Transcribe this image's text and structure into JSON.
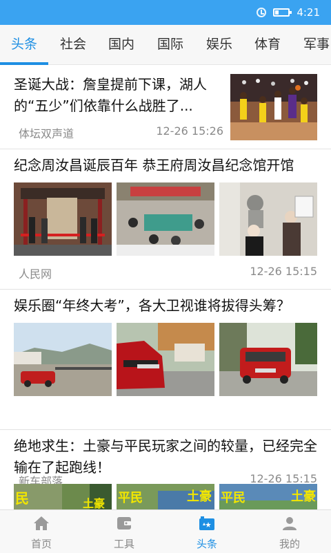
{
  "status_bar": {
    "time": "4:21",
    "battery_level": 0.25,
    "color": "#3aa3f1"
  },
  "tabs": [
    {
      "label": "头条",
      "active": true
    },
    {
      "label": "社会",
      "active": false
    },
    {
      "label": "国内",
      "active": false
    },
    {
      "label": "国际",
      "active": false
    },
    {
      "label": "娱乐",
      "active": false
    },
    {
      "label": "体育",
      "active": false
    },
    {
      "label": "军事",
      "active": false
    }
  ],
  "accent_color": "#1e8fe3",
  "articles": [
    {
      "title": "圣诞大战：詹皇提前下课，湖人的“五少”们依靠什么战胜了...",
      "source": "体坛双声道",
      "time": "12-26 15:26",
      "layout": "single-image",
      "image": "basketball-game-photo"
    },
    {
      "title": "纪念周汝昌诞辰百年 恭王府周汝昌纪念馆开馆",
      "source": "人民网",
      "time": "12-26 15:15",
      "layout": "three-images",
      "images": [
        "ribbon-cutting-photo",
        "meeting-room-photo",
        "exhibition-bust-photo"
      ]
    },
    {
      "title": "娱乐圈“年终大考”，各大卫视谁将拔得头筹？",
      "source": "新车部落",
      "time": "12-26 15:15",
      "layout": "three-images",
      "images": [
        "red-suv-village-photo",
        "red-suv-front-photo",
        "red-suv-street-photo"
      ]
    },
    {
      "title": "绝地求生：土豪与平民玩家之间的较量，已经完全输在了起跑线！",
      "layout": "three-images",
      "image_captions": [
        "民",
        "土豪",
        "平民",
        "土豪",
        "平民",
        "土豪"
      ],
      "images": [
        "game-screenshot-1",
        "game-screenshot-2",
        "game-screenshot-3"
      ]
    }
  ],
  "bottom_nav": [
    {
      "label": "首页",
      "icon": "home-icon",
      "active": false
    },
    {
      "label": "工具",
      "icon": "wallet-icon",
      "active": false
    },
    {
      "label": "头条",
      "icon": "headline-icon",
      "active": true
    },
    {
      "label": "我的",
      "icon": "user-icon",
      "active": false
    }
  ]
}
